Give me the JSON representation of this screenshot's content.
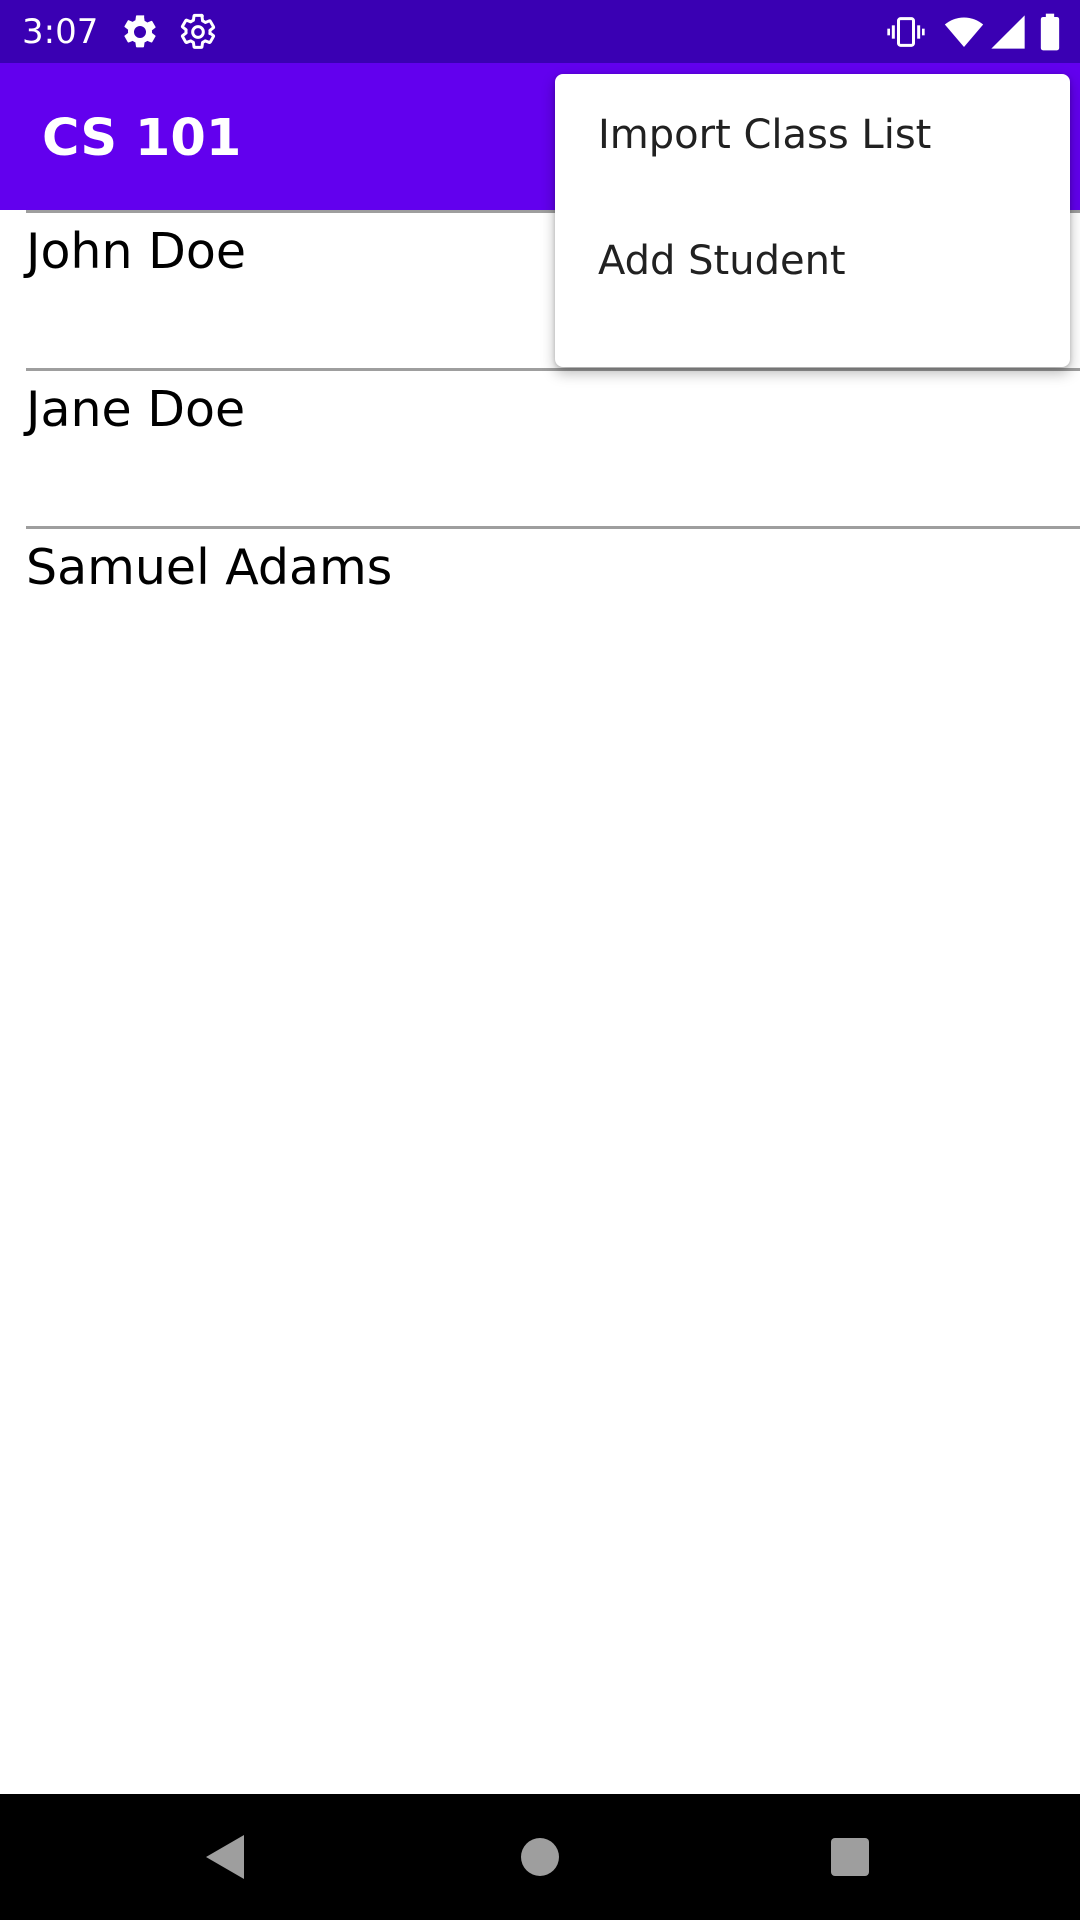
{
  "status_bar": {
    "time": "3:07",
    "left_icons": [
      "settings-icon",
      "settings-outline-icon"
    ],
    "right_icons": [
      "vibrate-icon",
      "wifi-icon",
      "signal-icon",
      "battery-icon"
    ]
  },
  "app_bar": {
    "title": "CS 101",
    "background": "#6200ee"
  },
  "students": [
    {
      "name": "John Doe"
    },
    {
      "name": "Jane Doe"
    },
    {
      "name": "Samuel Adams"
    }
  ],
  "menu": {
    "items": [
      {
        "label": "Import Class List"
      },
      {
        "label": "Add Student"
      }
    ]
  },
  "nav_bar": {
    "buttons": [
      "back-icon",
      "home-icon",
      "recents-icon"
    ]
  }
}
